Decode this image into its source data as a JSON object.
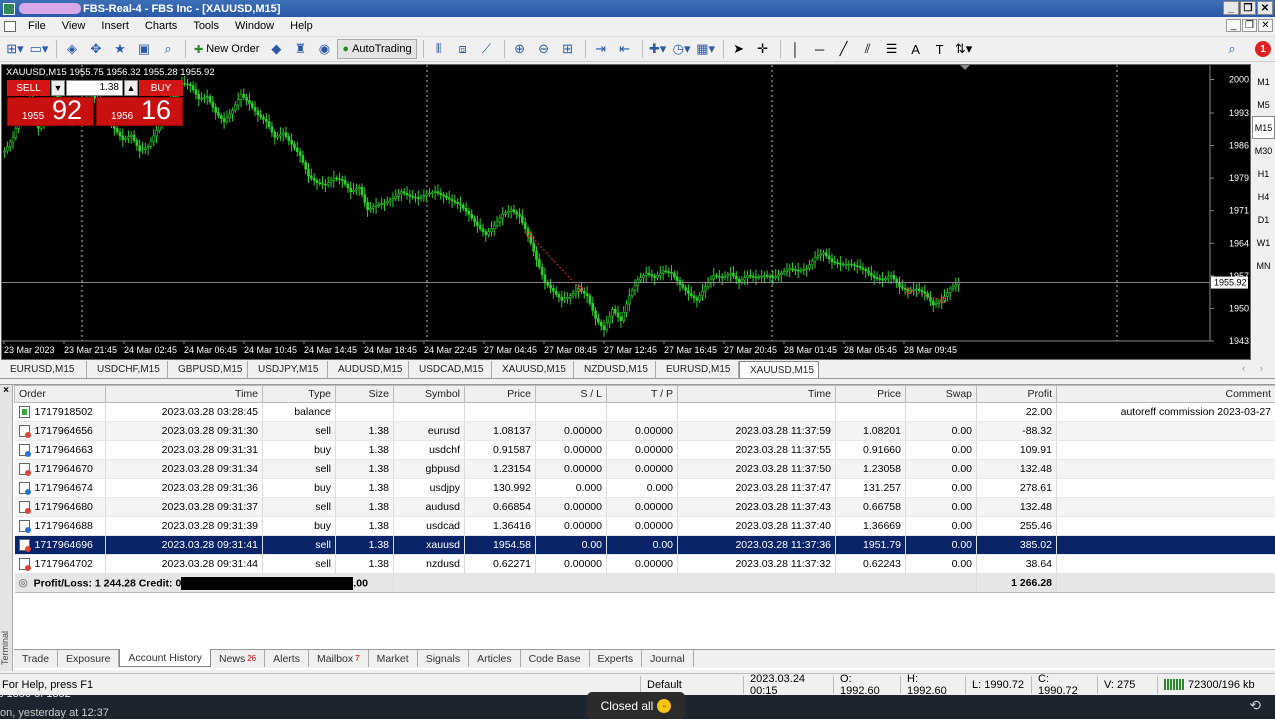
{
  "window": {
    "title_suffix": "FBS-Real-4 - FBS Inc - [XAUUSD,M15]"
  },
  "menu": [
    "File",
    "View",
    "Insert",
    "Charts",
    "Tools",
    "Window",
    "Help"
  ],
  "toolbar": {
    "new_order": "New Order",
    "autotrading": "AutoTrading"
  },
  "chart": {
    "info": "XAUUSD,M15  1955.75 1956.32 1955.28 1955.92",
    "oneclick": {
      "sell_label": "SELL",
      "buy_label": "BUY",
      "volume": "1.38",
      "sell_small": "1955",
      "sell_big": "92",
      "buy_small": "1956",
      "buy_big": "16"
    },
    "current_price": "1955.92"
  },
  "chart_data": {
    "type": "line",
    "title": "XAUUSD,M15",
    "y_ticks": [
      2000.8,
      1993.4,
      1986.2,
      1979.0,
      1971.8,
      1964.6,
      1957.4,
      1950.2,
      1943.0
    ],
    "y_tick_labels": [
      "2000.80",
      "1993.40",
      "1986.20",
      "1979.00",
      "1971.80",
      "1964.60",
      "1957.40",
      "1950.20",
      "1943.00"
    ],
    "x_tick_labels": [
      "23 Mar 2023",
      "23 Mar 21:45",
      "24 Mar 02:45",
      "24 Mar 06:45",
      "24 Mar 10:45",
      "24 Mar 14:45",
      "24 Mar 18:45",
      "24 Mar 22:45",
      "27 Mar 04:45",
      "27 Mar 08:45",
      "27 Mar 12:45",
      "27 Mar 16:45",
      "27 Mar 20:45",
      "28 Mar 01:45",
      "28 Mar 05:45",
      "28 Mar 09:45"
    ],
    "ylim": [
      1943.0,
      2004.0
    ],
    "series": [
      {
        "values": [
          1985.0,
          1988.0,
          1994.0,
          1996.0,
          1990.0,
          1993.0,
          1997.5,
          1995.0,
          1992.0,
          1994.5,
          1998.0,
          1996.0,
          1993.5,
          1990.0,
          1987.5,
          1988.5,
          1985.0,
          1986.0,
          1989.5,
          1994.0,
          1997.0,
          2000.0,
          1999.5,
          1996.5,
          1997.0,
          1993.5,
          1991.5,
          1994.0,
          1997.5,
          1995.5,
          1993.0,
          1991.5,
          1988.0,
          1989.0,
          1986.5,
          1984.0,
          1979.5,
          1978.0,
          1977.5,
          1979.0,
          1978.5,
          1976.0,
          1977.0,
          1972.0,
          1973.0,
          1973.5,
          1974.5,
          1976.0,
          1975.0,
          1974.5,
          1975.5,
          1976.0,
          1975.0,
          1974.0,
          1973.0,
          1971.0,
          1968.5,
          1966.5,
          1968.5,
          1971.0,
          1972.0,
          1970.5,
          1966.5,
          1961.0,
          1956.0,
          1954.0,
          1952.0,
          1953.0,
          1954.5,
          1953.0,
          1948.0,
          1945.5,
          1950.0,
          1947.5,
          1953.0,
          1956.5,
          1958.0,
          1957.0,
          1958.5,
          1958.0,
          1955.5,
          1953.5,
          1952.0,
          1955.0,
          1957.5,
          1957.0,
          1958.0,
          1956.0,
          1957.5,
          1957.0,
          1957.5,
          1957.0,
          1958.0,
          1959.0,
          1958.5,
          1959.0,
          1961.5,
          1962.5,
          1960.5,
          1960.0,
          1960.0,
          1959.5,
          1958.5,
          1957.0,
          1956.5,
          1957.5,
          1955.0,
          1954.0,
          1954.5,
          1953.5,
          1951.0,
          1952.0,
          1954.5,
          1955.9
        ]
      }
    ]
  },
  "chart_tabs": [
    "EURUSD,M15",
    "USDCHF,M15",
    "GBPUSD,M15",
    "USDJPY,M15",
    "AUDUSD,M15",
    "USDCAD,M15",
    "XAUUSD,M15",
    "NZDUSD,M15",
    "EURUSD,M15",
    "XAUUSD,M15"
  ],
  "timeframes": [
    "M1",
    "M5",
    "M15",
    "M30",
    "H1",
    "H4",
    "D1",
    "W1",
    "MN"
  ],
  "history": {
    "columns": [
      "Order",
      "Time",
      "Type",
      "Size",
      "Symbol",
      "Price",
      "S / L",
      "T / P",
      "Time",
      "Price",
      "Swap",
      "Profit",
      "Comment"
    ],
    "rows": [
      {
        "order": "1717918502",
        "open_time": "2023.03.28 03:28:45",
        "type": "balance",
        "size": "",
        "symbol": "",
        "price": "",
        "sl": "",
        "tp": "",
        "close_time": "",
        "close_price": "",
        "swap": "",
        "profit": "22.00",
        "comment": "autoreff commission 2023-03-27"
      },
      {
        "order": "1717964656",
        "open_time": "2023.03.28 09:31:30",
        "type": "sell",
        "size": "1.38",
        "symbol": "eurusd",
        "price": "1.08137",
        "sl": "0.00000",
        "tp": "0.00000",
        "close_time": "2023.03.28 11:37:59",
        "close_price": "1.08201",
        "swap": "0.00",
        "profit": "-88.32",
        "comment": ""
      },
      {
        "order": "1717964663",
        "open_time": "2023.03.28 09:31:31",
        "type": "buy",
        "size": "1.38",
        "symbol": "usdchf",
        "price": "0.91587",
        "sl": "0.00000",
        "tp": "0.00000",
        "close_time": "2023.03.28 11:37:55",
        "close_price": "0.91660",
        "swap": "0.00",
        "profit": "109.91",
        "comment": ""
      },
      {
        "order": "1717964670",
        "open_time": "2023.03.28 09:31:34",
        "type": "sell",
        "size": "1.38",
        "symbol": "gbpusd",
        "price": "1.23154",
        "sl": "0.00000",
        "tp": "0.00000",
        "close_time": "2023.03.28 11:37:50",
        "close_price": "1.23058",
        "swap": "0.00",
        "profit": "132.48",
        "comment": ""
      },
      {
        "order": "1717964674",
        "open_time": "2023.03.28 09:31:36",
        "type": "buy",
        "size": "1.38",
        "symbol": "usdjpy",
        "price": "130.992",
        "sl": "0.000",
        "tp": "0.000",
        "close_time": "2023.03.28 11:37:47",
        "close_price": "131.257",
        "swap": "0.00",
        "profit": "278.61",
        "comment": ""
      },
      {
        "order": "1717964680",
        "open_time": "2023.03.28 09:31:37",
        "type": "sell",
        "size": "1.38",
        "symbol": "audusd",
        "price": "0.66854",
        "sl": "0.00000",
        "tp": "0.00000",
        "close_time": "2023.03.28 11:37:43",
        "close_price": "0.66758",
        "swap": "0.00",
        "profit": "132.48",
        "comment": ""
      },
      {
        "order": "1717964688",
        "open_time": "2023.03.28 09:31:39",
        "type": "buy",
        "size": "1.38",
        "symbol": "usdcad",
        "price": "1.36416",
        "sl": "0.00000",
        "tp": "0.00000",
        "close_time": "2023.03.28 11:37:40",
        "close_price": "1.36669",
        "swap": "0.00",
        "profit": "255.46",
        "comment": ""
      },
      {
        "order": "1717964696",
        "open_time": "2023.03.28 09:31:41",
        "type": "sell",
        "size": "1.38",
        "symbol": "xauusd",
        "price": "1954.58",
        "sl": "0.00",
        "tp": "0.00",
        "close_time": "2023.03.28 11:37:36",
        "close_price": "1951.79",
        "swap": "0.00",
        "profit": "385.02",
        "comment": ""
      },
      {
        "order": "1717964702",
        "open_time": "2023.03.28 09:31:44",
        "type": "sell",
        "size": "1.38",
        "symbol": "nzdusd",
        "price": "0.62271",
        "sl": "0.00000",
        "tp": "0.00000",
        "close_time": "2023.03.28 11:37:32",
        "close_price": "0.62243",
        "swap": "0.00",
        "profit": "38.64",
        "comment": ""
      }
    ],
    "summary_prefix": "Profit/Loss: 1 244.28  Credit: 0",
    "summary_suffix": ".00",
    "summary_total": "1 266.28"
  },
  "terminal_label": "Terminal",
  "terminal_tabs": [
    {
      "label": "Trade"
    },
    {
      "label": "Exposure"
    },
    {
      "label": "Account History"
    },
    {
      "label": "News",
      "badge": "26"
    },
    {
      "label": "Alerts"
    },
    {
      "label": "Mailbox",
      "badge": "7"
    },
    {
      "label": "Market"
    },
    {
      "label": "Signals"
    },
    {
      "label": "Articles"
    },
    {
      "label": "Code Base"
    },
    {
      "label": "Experts"
    },
    {
      "label": "Journal"
    }
  ],
  "status": {
    "help": "For Help, press F1",
    "profile": "Default",
    "datetime": "2023.03.24 00:15",
    "open": "O: 1992.60",
    "high": "H: 1992.60",
    "low": "L: 1990.72",
    "close": "C: 1990.72",
    "volume": "V: 275",
    "traffic": "72300/196 kb"
  },
  "taskbar": {
    "counter": "s 1350 of 1352",
    "msg": "on, yesterday at 12:37",
    "toast": "Closed all"
  }
}
